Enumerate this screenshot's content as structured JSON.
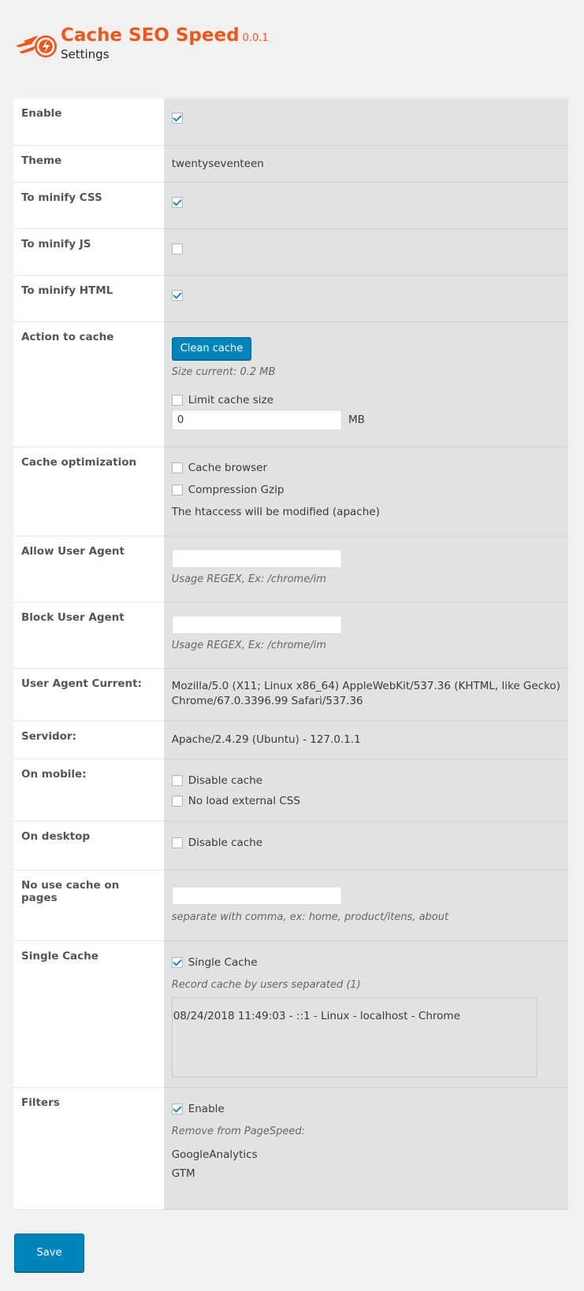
{
  "header": {
    "app_title": "Cache SEO Speed",
    "version": "0.0.1",
    "subtitle": "Settings",
    "brand_color": "#f1561d"
  },
  "rows": {
    "enable": {
      "label": "Enable",
      "checked": true
    },
    "theme": {
      "label": "Theme",
      "value": "twentyseventeen"
    },
    "minify_css": {
      "label": "To minify CSS",
      "checked": true
    },
    "minify_js": {
      "label": "To minify JS",
      "checked": false
    },
    "minify_html": {
      "label": "To minify HTML",
      "checked": true
    },
    "action_to_cache": {
      "label": "Action to cache",
      "clean_button": "Clean cache",
      "size_current": "Size current: 0.2 MB",
      "limit_label": "Limit cache size",
      "limit_checked": false,
      "limit_value": "0",
      "unit": "MB"
    },
    "cache_optimization": {
      "label": "Cache optimization",
      "cache_browser": "Cache browser",
      "compression_gzip": "Compression Gzip",
      "note": "The htaccess will be modified (apache)"
    },
    "allow_user_agent": {
      "label": "Allow User Agent",
      "value": "",
      "hint": "Usage REGEX, Ex: /chrome/im"
    },
    "block_user_agent": {
      "label": "Block User Agent",
      "value": "",
      "hint": "Usage REGEX, Ex: /chrome/im"
    },
    "user_agent_current": {
      "label": "User Agent Current:",
      "line1": "Mozilla/5.0 (X11; Linux x86_64) AppleWebKit/537.36 (KHTML, like Gecko)",
      "line2": "Chrome/67.0.3396.99 Safari/537.36"
    },
    "servidor": {
      "label": "Servidor:",
      "value": "Apache/2.4.29 (Ubuntu) - 127.0.1.1"
    },
    "on_mobile": {
      "label": "On mobile:",
      "disable_cache": "Disable cache",
      "no_load_css": "No load external CSS"
    },
    "on_desktop": {
      "label": "On desktop",
      "disable_cache": "Disable cache"
    },
    "no_use_cache": {
      "label": "No use cache on pages",
      "value": "",
      "hint": "separate with comma, ex: home, product/itens, about"
    },
    "single_cache": {
      "label": "Single Cache",
      "option": "Single Cache",
      "checked": true,
      "record_label": "Record cache by users separated (1)",
      "log_entry": "08/24/2018 11:49:03 - ::1 - Linux - localhost - Chrome"
    },
    "filters": {
      "label": "Filters",
      "option": "Enable",
      "checked": true,
      "remove_label": "Remove from PageSpeed:",
      "item1": "GoogleAnalytics",
      "item2": "GTM"
    }
  },
  "footer": {
    "save_label": "Save"
  }
}
